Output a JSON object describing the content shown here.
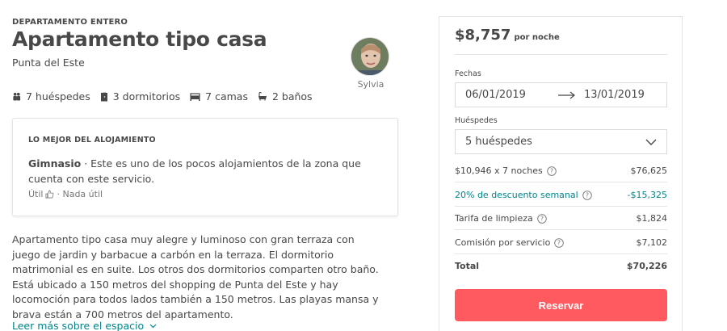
{
  "listing": {
    "kicker": "DEPARTAMENTO ENTERO",
    "title": "Apartamento tipo casa",
    "location": "Punta del Este",
    "host_name": "Sylvia",
    "amenities": [
      {
        "icon": "guests-icon",
        "label": "7 huéspedes"
      },
      {
        "icon": "door-icon",
        "label": "3 dormitorios"
      },
      {
        "icon": "bed-icon",
        "label": "7 camas"
      },
      {
        "icon": "bath-icon",
        "label": "2 baños"
      }
    ]
  },
  "highlight": {
    "label": "LO MEJOR DEL ALOJAMIENTO",
    "feature": "Gimnasio",
    "separator": " · ",
    "text": "Este es uno de los pocos alojamientos de la zona que cuenta con este servicio.",
    "useful": "Útil",
    "not_useful": "· Nada útil"
  },
  "description": {
    "text": "Apartamento tipo casa muy alegre y luminoso con gran terraza con juego de jardin y barbacue a carbón en la terraza. El dormitorio matrimonial es en suite. Los otros dos dormitorios comparten otro baño. Está ubicado a 150 metros del shopping de Punta del Este y hay locomoción para todos lados también a 150 metros. Las playas mansa y brava están a 700 metros del apartamento.",
    "more_link": "Leer más sobre el espacio"
  },
  "booking": {
    "price": "$8,757",
    "price_unit": "por noche",
    "dates_label": "Fechas",
    "check_in": "06/01/2019",
    "check_out": "13/01/2019",
    "guests_label": "Huéspedes",
    "guests_value": "5 huéspedes",
    "lines": [
      {
        "label": "$10,946 x 7 noches",
        "amount": "$76,625"
      },
      {
        "label": "20% de descuento semanal",
        "amount": "-$15,325"
      },
      {
        "label": "Tarifa de limpieza",
        "amount": "$1,824"
      },
      {
        "label": "Comisión por servicio",
        "amount": "$7,102"
      }
    ],
    "total_label": "Total",
    "total_amount": "$70,226",
    "reserve_label": "Reservar"
  },
  "colors": {
    "accent": "#ff5a5f",
    "teal": "#008489",
    "text": "#484848"
  }
}
